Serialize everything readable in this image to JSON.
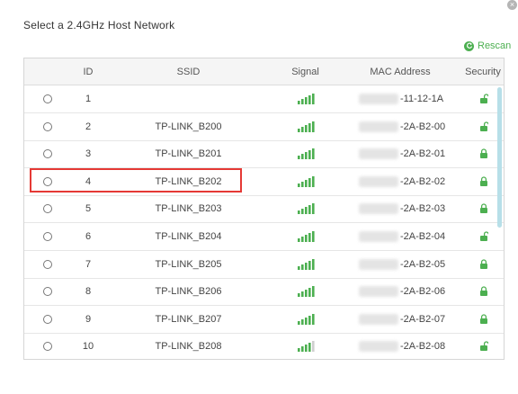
{
  "dialog": {
    "title": "Select a 2.4GHz Host Network",
    "close_glyph": "×",
    "rescan_label": "Rescan"
  },
  "table": {
    "headers": {
      "id": "ID",
      "ssid": "SSID",
      "signal": "Signal",
      "mac": "MAC Address",
      "security": "Security"
    },
    "rows": [
      {
        "id": "1",
        "ssid": "",
        "mac_visible": "-11-12-1A",
        "signal_bars": 5,
        "lock": "unlocked"
      },
      {
        "id": "2",
        "ssid": "TP-LINK_B200",
        "mac_visible": "-2A-B2-00",
        "signal_bars": 5,
        "lock": "unlocked"
      },
      {
        "id": "3",
        "ssid": "TP-LINK_B201",
        "mac_visible": "-2A-B2-01",
        "signal_bars": 5,
        "lock": "locked"
      },
      {
        "id": "4",
        "ssid": "TP-LINK_B202",
        "mac_visible": "-2A-B2-02",
        "signal_bars": 5,
        "lock": "locked"
      },
      {
        "id": "5",
        "ssid": "TP-LINK_B203",
        "mac_visible": "-2A-B2-03",
        "signal_bars": 5,
        "lock": "locked"
      },
      {
        "id": "6",
        "ssid": "TP-LINK_B204",
        "mac_visible": "-2A-B2-04",
        "signal_bars": 5,
        "lock": "unlocked"
      },
      {
        "id": "7",
        "ssid": "TP-LINK_B205",
        "mac_visible": "-2A-B2-05",
        "signal_bars": 5,
        "lock": "locked"
      },
      {
        "id": "8",
        "ssid": "TP-LINK_B206",
        "mac_visible": "-2A-B2-06",
        "signal_bars": 5,
        "lock": "locked"
      },
      {
        "id": "9",
        "ssid": "TP-LINK_B207",
        "mac_visible": "-2A-B2-07",
        "signal_bars": 5,
        "lock": "locked"
      },
      {
        "id": "10",
        "ssid": "TP-LINK_B208",
        "mac_visible": "-2A-B2-08",
        "signal_bars": 4,
        "lock": "unlocked"
      }
    ]
  },
  "colors": {
    "accent_green": "#4caf50",
    "highlight_red": "#e53935",
    "scrollbar": "#b7dfe8"
  }
}
